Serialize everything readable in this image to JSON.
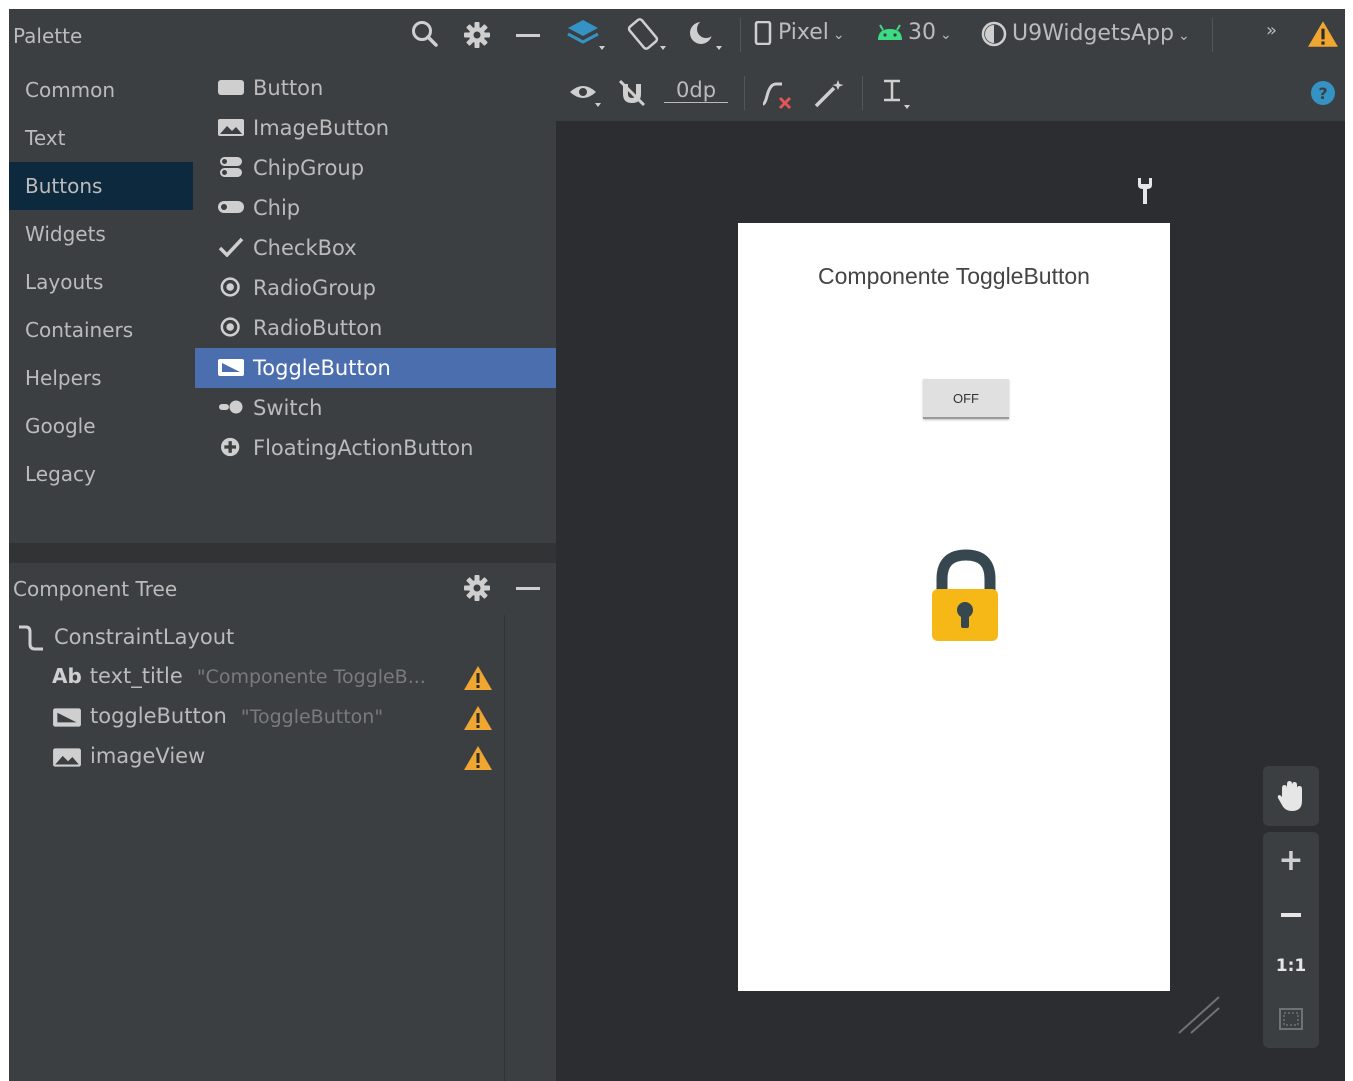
{
  "palette": {
    "title": "Palette",
    "categories": [
      {
        "label": "Common"
      },
      {
        "label": "Text"
      },
      {
        "label": "Buttons",
        "selected": true
      },
      {
        "label": "Widgets"
      },
      {
        "label": "Layouts"
      },
      {
        "label": "Containers"
      },
      {
        "label": "Helpers"
      },
      {
        "label": "Google"
      },
      {
        "label": "Legacy"
      }
    ],
    "widgets": [
      {
        "label": "Button",
        "icon": "button-icon"
      },
      {
        "label": "ImageButton",
        "icon": "image-button-icon"
      },
      {
        "label": "ChipGroup",
        "icon": "chip-group-icon"
      },
      {
        "label": "Chip",
        "icon": "chip-icon"
      },
      {
        "label": "CheckBox",
        "icon": "checkmark-icon"
      },
      {
        "label": "RadioGroup",
        "icon": "radio-group-icon"
      },
      {
        "label": "RadioButton",
        "icon": "radio-button-icon"
      },
      {
        "label": "ToggleButton",
        "icon": "toggle-button-icon",
        "selected": true
      },
      {
        "label": "Switch",
        "icon": "switch-icon"
      },
      {
        "label": "FloatingActionButton",
        "icon": "fab-plus-icon"
      }
    ]
  },
  "component_tree": {
    "title": "Component Tree",
    "root": "ConstraintLayout",
    "items": [
      {
        "prefix": "Ab",
        "label": "text_title",
        "hint": "\"Componente ToggleB...",
        "warning": true
      },
      {
        "label": "toggleButton",
        "hint": "\"ToggleButton\"",
        "warning": true
      },
      {
        "label": "imageView",
        "hint": "",
        "warning": true
      }
    ]
  },
  "toolbar": {
    "device": "Pixel",
    "api_level": "30",
    "theme": "U9WidgetsApp",
    "more": "»",
    "margin": "0dp"
  },
  "device_preview": {
    "title": "Componente ToggleButton",
    "toggle_label": "OFF"
  },
  "zoom": {
    "actual_size": "1:1"
  },
  "colors": {
    "panel": "#3c3f41",
    "selected_category": "#0d293e",
    "selected_widget": "#4b6eaf",
    "warning": "#f0a732",
    "lock_body": "#f6b816",
    "lock_shackle": "#37474f"
  }
}
